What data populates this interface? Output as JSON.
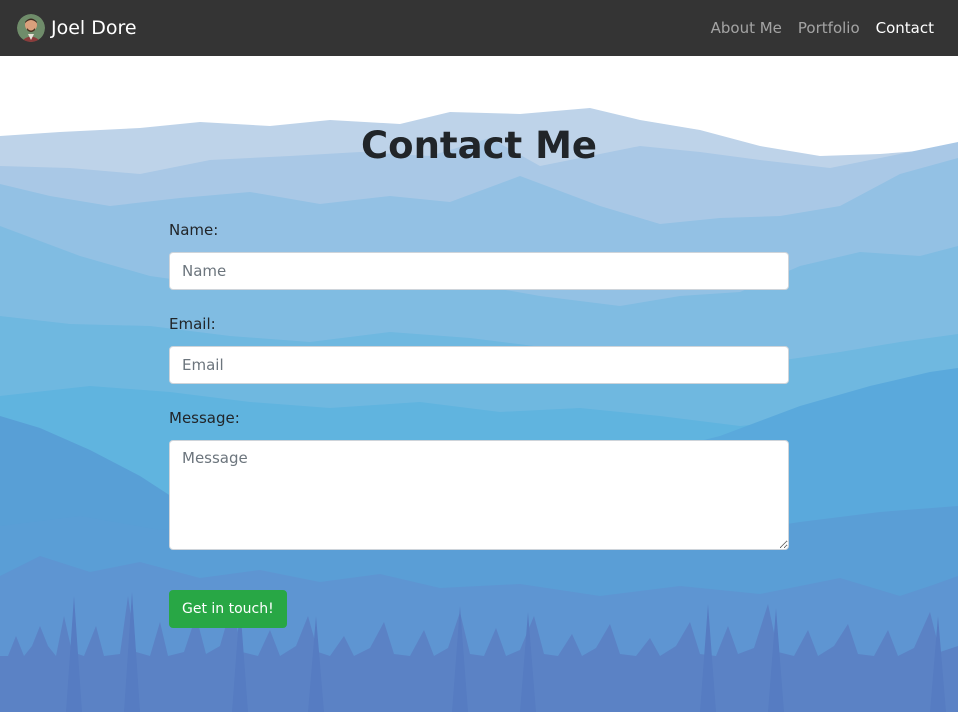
{
  "navbar": {
    "brand_name": "Joel Dore",
    "links": [
      {
        "label": "About Me",
        "active": false
      },
      {
        "label": "Portfolio",
        "active": false
      },
      {
        "label": "Contact",
        "active": true
      }
    ]
  },
  "page": {
    "title": "Contact Me"
  },
  "form": {
    "name": {
      "label": "Name:",
      "placeholder": "Name",
      "value": ""
    },
    "email": {
      "label": "Email:",
      "placeholder": "Email",
      "value": ""
    },
    "message": {
      "label": "Message:",
      "placeholder": "Message",
      "value": ""
    },
    "submit_label": "Get in touch!"
  },
  "colors": {
    "navbar_bg": "#343434",
    "submit_button": "#28a745",
    "sky_mountains": "#b8d3ea",
    "forest": "#5b82c5"
  },
  "icons": {
    "brand_avatar": "avatar-icon",
    "resize_handle": "resize-handle-icon"
  }
}
